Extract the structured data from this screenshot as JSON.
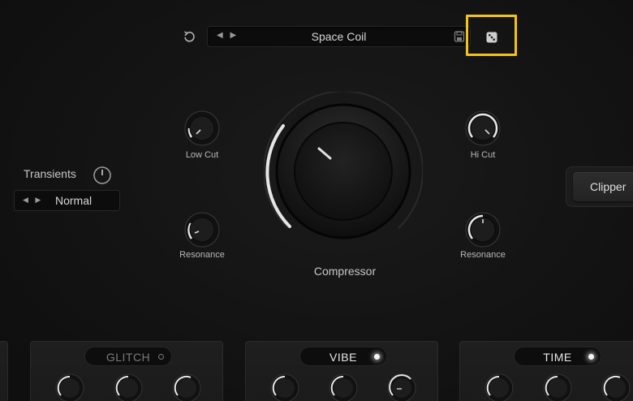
{
  "toolbar": {
    "reset_icon": "undo-icon",
    "preset_name": "Space Coil",
    "prev_next_icons": "left-right-arrows-icon",
    "save_icon": "floppy-disk-icon",
    "random_icon": "dice-icon",
    "highlight_color": "#f2c318"
  },
  "transients": {
    "label": "Transients",
    "mode": "Normal",
    "mode_arrows": "left-right-arrows-icon"
  },
  "filters": {
    "low_cut_label": "Low Cut",
    "hi_cut_label": "Hi Cut",
    "resonance_left_label": "Resonance",
    "resonance_right_label": "Resonance"
  },
  "compressor": {
    "label": "Compressor"
  },
  "clipper": {
    "label": "Clipper"
  },
  "modules": [
    {
      "title": "GLITCH",
      "enabled": false
    },
    {
      "title": "VIBE",
      "enabled": true
    },
    {
      "title": "TIME",
      "enabled": true
    }
  ],
  "colors": {
    "background": "#141414",
    "text": "#cfcfcf",
    "arc": "#e8e8e8"
  }
}
